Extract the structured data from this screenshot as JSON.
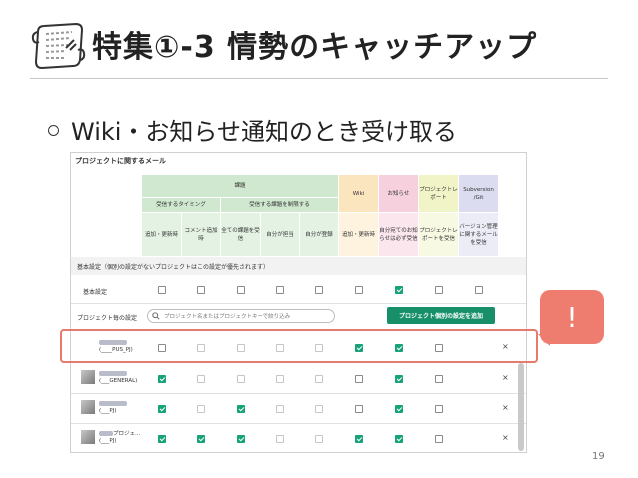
{
  "slide": {
    "title": "特集①-3 情勢のキャッチアップ",
    "bullet": "Wiki・お知らせ通知のとき受け取る",
    "page_number": "19",
    "callout": "!"
  },
  "screenshot": {
    "title": "プロジェクトに関するメール",
    "groups": {
      "task": "課題",
      "wiki": "Wiki",
      "news": "お知らせ",
      "report": "プロジェクトレポート",
      "vcs": "Subversion /Git"
    },
    "subgroups": {
      "timing": "受信するタイミング",
      "limit": "受信する課題を制限する"
    },
    "columns": [
      "追加・更新時",
      "コメント追加時",
      "全ての課題を受信",
      "自分が担当",
      "自分が登録",
      "追加・更新時",
      "自分宛てのお知らせは必ず受信",
      "プロジェクトレポートを受信",
      "バージョン管理に関するメールを受信"
    ],
    "basic_band": "基本設定（個別の設定がないプロジェクトはこの設定が優先されます）",
    "basic_label": "基本設定",
    "basic_values": [
      false,
      false,
      false,
      false,
      false,
      false,
      true,
      false,
      false
    ],
    "per_project_label": "プロジェクト毎の設定",
    "filter_placeholder": "プロジェクト名またはプロジェクトキーで絞り込み",
    "add_button": "プロジェクト個別の設定を追加",
    "close_label": "×",
    "projects": [
      {
        "name": "",
        "key": "(____PUS_PJ)",
        "values": [
          false,
          false,
          false,
          false,
          false,
          true,
          true,
          false
        ]
      },
      {
        "name": "",
        "key": "(___GENERAL)",
        "values": [
          true,
          false,
          false,
          false,
          false,
          false,
          true,
          false
        ]
      },
      {
        "name": "",
        "key": "(___PJ)",
        "values": [
          true,
          false,
          true,
          false,
          false,
          false,
          true,
          false
        ]
      },
      {
        "name": "プロジェ...",
        "key": "(___PJ)",
        "values": [
          true,
          true,
          true,
          false,
          false,
          true,
          true,
          false
        ]
      }
    ]
  }
}
